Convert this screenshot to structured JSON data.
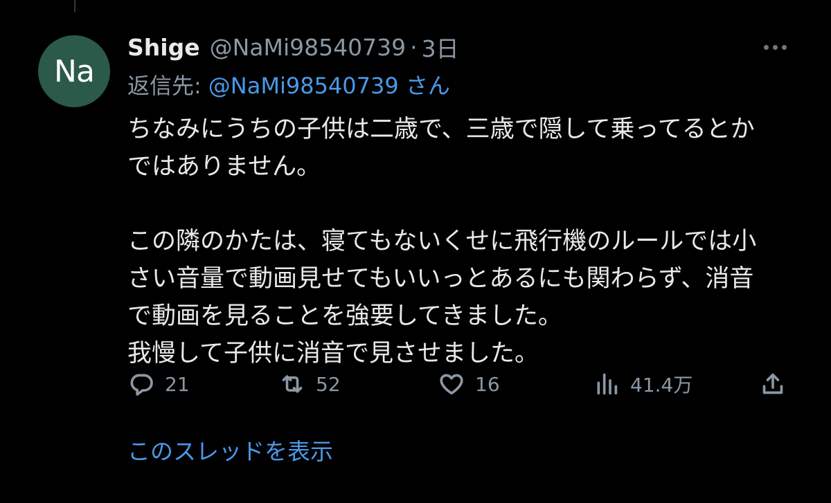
{
  "avatar": {
    "initials": "Na",
    "color": "#2c5a4a"
  },
  "tweet": {
    "display_name": "Shige",
    "handle": "@NaMi98540739",
    "separator": "·",
    "time": "3日",
    "reply_prefix": "返信先:",
    "reply_target": "@NaMi98540739 さん",
    "paragraphs": [
      "ちなみにうちの子供は二歳で、三歳で隠して乗ってるとか\nではありません。",
      "この隣のかたは、寝てもないくせに飛行機のルールでは小\nさい音量で動画見せてもいいっとあるにも関わらず、消音\nで動画を見ることを強要してきました。\n我慢して子供に消音で見させました。"
    ]
  },
  "actions": {
    "reply": {
      "icon": "reply-icon",
      "count": "21"
    },
    "retweet": {
      "icon": "retweet-icon",
      "count": "52"
    },
    "like": {
      "icon": "heart-icon",
      "count": "16"
    },
    "views": {
      "icon": "views-icon",
      "count": "41.4万"
    },
    "share": {
      "icon": "share-icon"
    }
  },
  "show_thread": "このスレッドを表示",
  "colors": {
    "background": "#000000",
    "text": "#e7e9ea",
    "muted": "#8b98a5",
    "link": "#4a99e9"
  }
}
